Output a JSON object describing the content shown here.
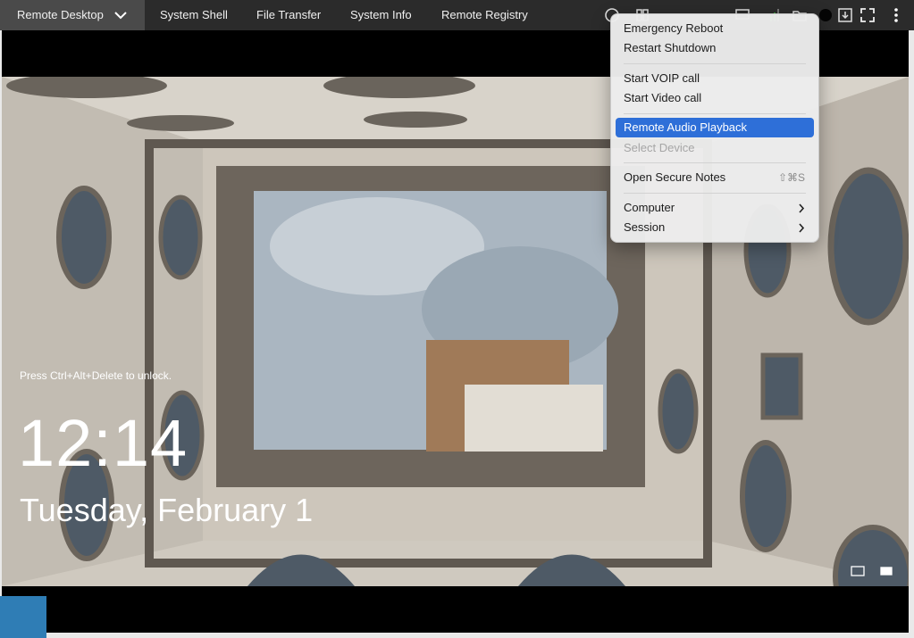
{
  "topbar": {
    "tabs": [
      {
        "label": "Remote Desktop"
      },
      {
        "label": "System Shell"
      },
      {
        "label": "File Transfer"
      },
      {
        "label": "System Info"
      },
      {
        "label": "Remote Registry"
      }
    ]
  },
  "lockscreen": {
    "hint": "Press Ctrl+Alt+Delete to unlock.",
    "time": "12:14",
    "date": "Tuesday, February 1"
  },
  "menu": {
    "items": [
      {
        "label": "Emergency Reboot"
      },
      {
        "label": "Restart Shutdown"
      },
      {
        "label": "Start VOIP call"
      },
      {
        "label": "Start Video call"
      },
      {
        "label": "Remote Audio Playback",
        "selected": true
      },
      {
        "label": "Select Device",
        "disabled": true
      },
      {
        "label": "Open Secure Notes",
        "shortcut": "⇧⌘S"
      },
      {
        "label": "Computer",
        "submenu": true
      },
      {
        "label": "Session",
        "submenu": true
      }
    ]
  },
  "colors": {
    "topbar": "#2b2b2b",
    "active_tab": "#4a4a4a",
    "menu_highlight": "#2e6fd8"
  },
  "icons": [
    "chevron-down-icon",
    "help-icon",
    "layout-icon",
    "monitor-icon",
    "network-icon",
    "folder-icon",
    "record-icon",
    "download-icon",
    "fullscreen-icon",
    "more-icon",
    "keyboard-icon",
    "battery-icon",
    "chevron-right-icon"
  ]
}
